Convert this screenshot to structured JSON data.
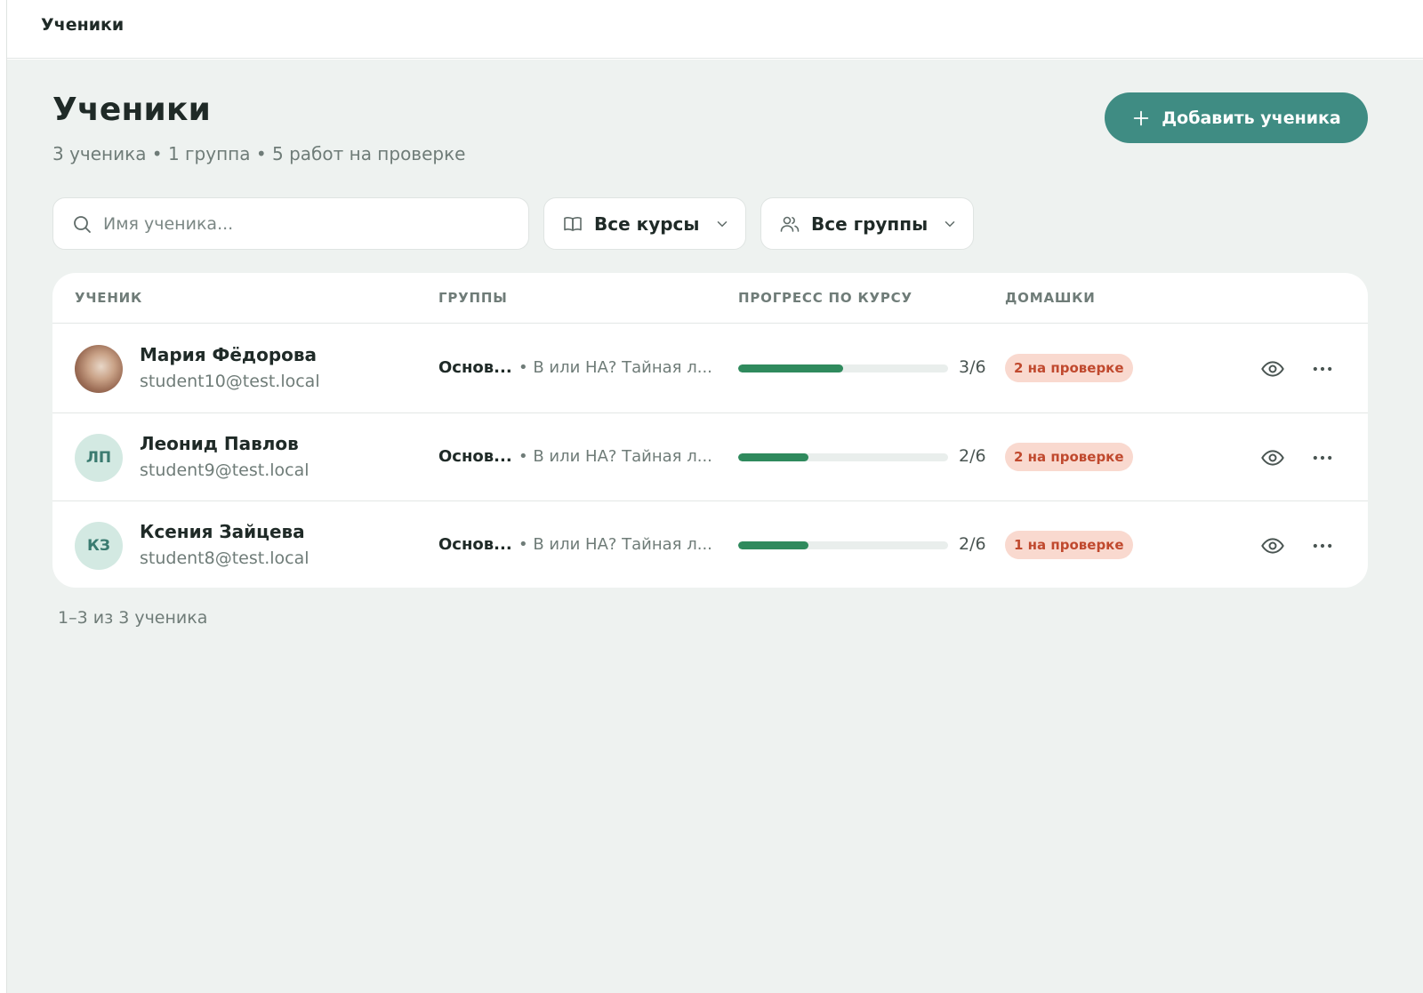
{
  "topbar": {
    "title": "Ученики"
  },
  "page": {
    "title": "Ученики",
    "subtitle": "3 ученика • 1 группа • 5 работ на проверке",
    "add_button_label": "Добавить ученика"
  },
  "search": {
    "placeholder": "Имя ученика..."
  },
  "filters": {
    "courses_label": "Все курсы",
    "groups_label": "Все группы"
  },
  "table": {
    "headers": {
      "student": "УЧЕНИК",
      "groups": "ГРУППЫ",
      "progress": "ПРОГРЕСС ПО КУРСУ",
      "homework": "ДОМАШКИ"
    },
    "rows": [
      {
        "avatar_type": "photo",
        "initials": "",
        "name": "Мария Фёдорова",
        "email": "student10@test.local",
        "group": "Основ...",
        "group_extra": "• В или НА? Тайная л...",
        "progress_done": 3,
        "progress_total": 6,
        "progress_label": "3/6",
        "homework_badge": "2 на проверке"
      },
      {
        "avatar_type": "initials",
        "initials": "ЛП",
        "name": "Леонид Павлов",
        "email": "student9@test.local",
        "group": "Основ...",
        "group_extra": "• В или НА? Тайная л...",
        "progress_done": 2,
        "progress_total": 6,
        "progress_label": "2/6",
        "homework_badge": "2 на проверке"
      },
      {
        "avatar_type": "initials",
        "initials": "КЗ",
        "name": "Ксения Зайцева",
        "email": "student8@test.local",
        "group": "Основ...",
        "group_extra": "• В или НА? Тайная л...",
        "progress_done": 2,
        "progress_total": 6,
        "progress_label": "2/6",
        "homework_badge": "1 на проверке"
      }
    ]
  },
  "pagination": {
    "text": "1–3 из 3 ученика"
  },
  "colors": {
    "accent": "#3f8c83",
    "progress": "#2f8a5d",
    "badge_bg": "#f9d9cf",
    "badge_text": "#c0492e",
    "background": "#eef2f0"
  },
  "icons": {
    "add": "plus-icon",
    "search": "search-icon",
    "courses": "book-icon",
    "groups": "users-icon",
    "dropdown": "chevron-down-icon",
    "view": "eye-icon",
    "more": "more-horizontal-icon"
  }
}
